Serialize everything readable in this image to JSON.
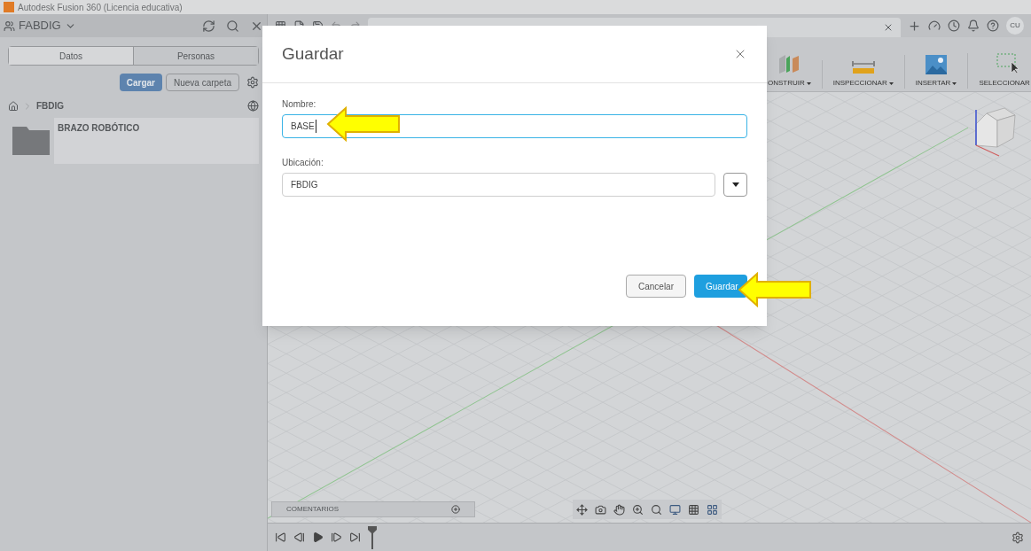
{
  "title_bar": {
    "title": "Autodesk Fusion 360 (Licencia educativa)"
  },
  "data_panel": {
    "project": "FABDIG",
    "tabs": [
      {
        "label": "Datos",
        "selected": true
      },
      {
        "label": "Personas",
        "selected": false
      }
    ],
    "upload_button": "Cargar",
    "new_folder_button": "Nueva carpeta",
    "breadcrumb": "FBDIG",
    "items": [
      {
        "name": "BRAZO ROBÓTICO"
      }
    ]
  },
  "top_bar": {
    "user_initials": "CU"
  },
  "toolbar": {
    "groups": [
      {
        "label": "ONSTRUIR",
        "kind": "build"
      },
      {
        "label": "INSPECCIONAR",
        "kind": "inspect"
      },
      {
        "label": "INSERTAR",
        "kind": "insert"
      },
      {
        "label": "SELECCIONAR",
        "kind": "select"
      }
    ]
  },
  "comments": {
    "label": "COMENTARIOS"
  },
  "dialog": {
    "title": "Guardar",
    "name_label": "Nombre:",
    "name_value": "BASE",
    "location_label": "Ubicación:",
    "location_value": "FBDIG",
    "cancel": "Cancelar",
    "save": "Guardar"
  }
}
